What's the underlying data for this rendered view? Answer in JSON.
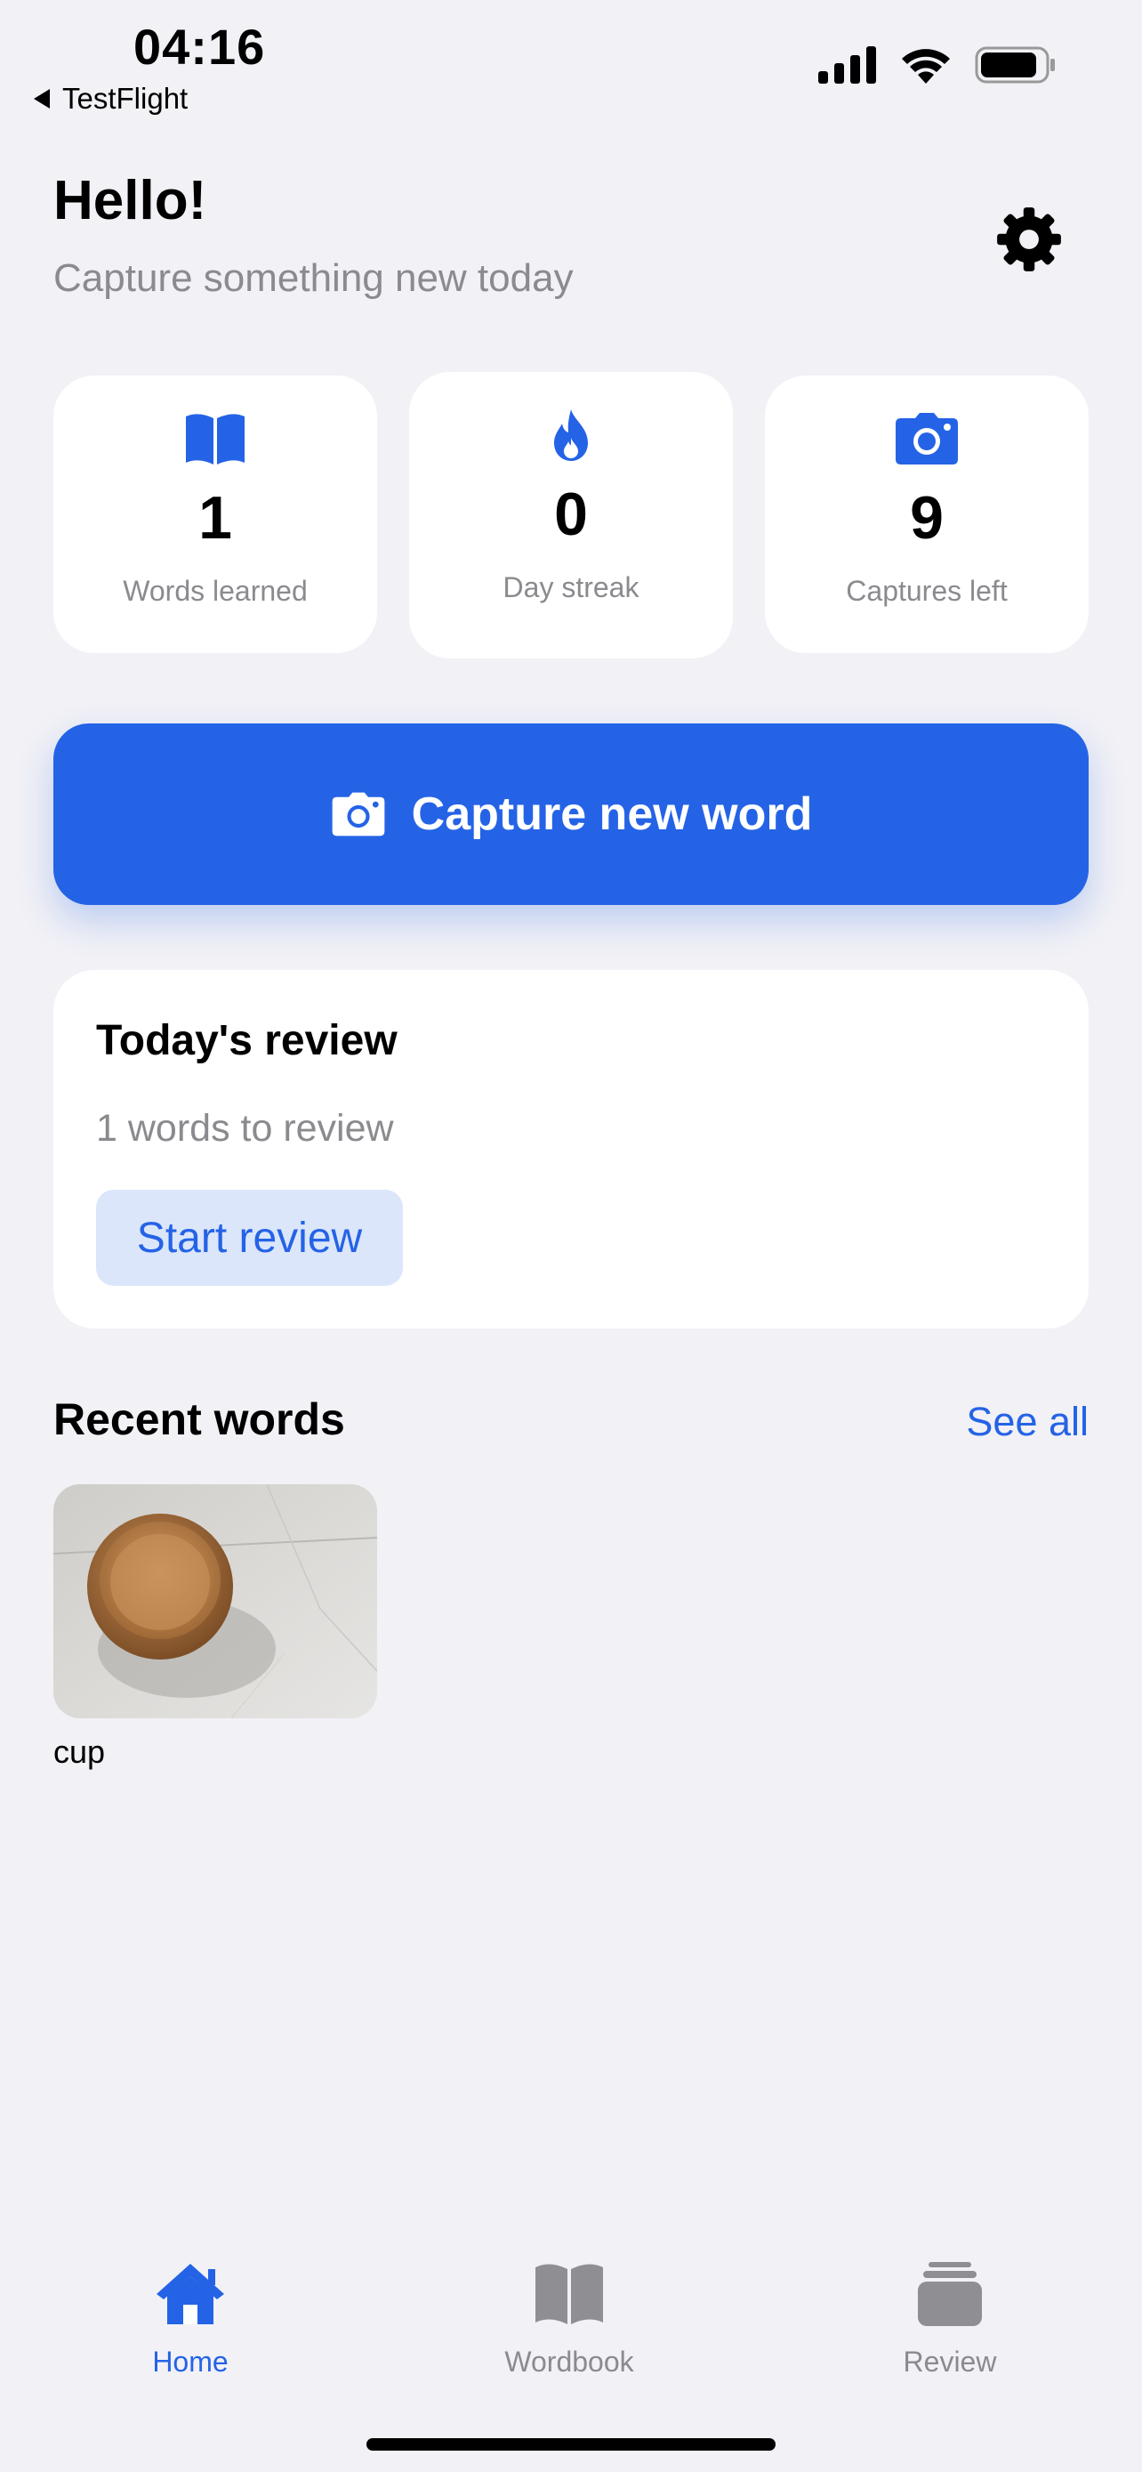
{
  "status_bar": {
    "time": "04:16",
    "back_app": "TestFlight",
    "icons": [
      "cellular-signal-icon",
      "wifi-icon",
      "battery-icon"
    ]
  },
  "header": {
    "greeting": "Hello!",
    "subtitle": "Capture something new today",
    "settings_icon": "gear-icon"
  },
  "stats": [
    {
      "icon": "book-icon",
      "value": "1",
      "label": "Words learned"
    },
    {
      "icon": "flame-icon",
      "value": "0",
      "label": "Day streak"
    },
    {
      "icon": "camera-icon",
      "value": "9",
      "label": "Captures left"
    }
  ],
  "capture": {
    "label": "Capture new word",
    "icon": "camera-icon"
  },
  "review": {
    "title": "Today's review",
    "count_text": "1 words to review",
    "button_label": "Start review"
  },
  "recent": {
    "title": "Recent words",
    "see_all": "See all",
    "words": [
      {
        "label": "cup",
        "image": "bowl-photo"
      }
    ]
  },
  "tab_bar": {
    "tabs": [
      {
        "label": "Home",
        "icon": "house-icon",
        "active": true
      },
      {
        "label": "Wordbook",
        "icon": "book-icon",
        "active": false
      },
      {
        "label": "Review",
        "icon": "card-stack-icon",
        "active": false
      }
    ]
  },
  "colors": {
    "accent": "#2563e6",
    "background": "#f1f1f6",
    "secondary_text": "#8a8a8f",
    "inactive_tab": "#8e8e93"
  }
}
